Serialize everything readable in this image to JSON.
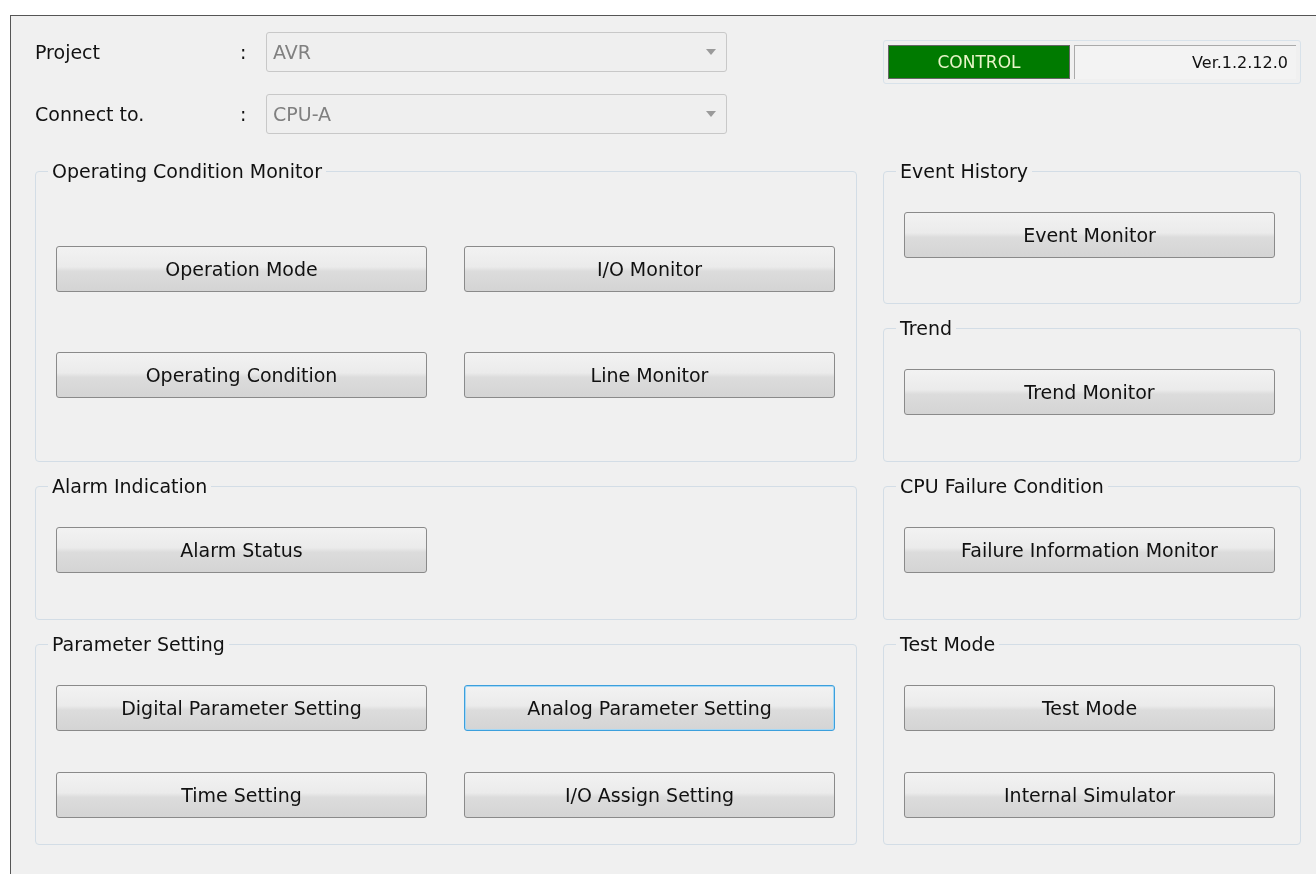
{
  "header": {
    "fields": [
      {
        "label": "Project",
        "separator": ":",
        "value": "AVR",
        "disabled": true
      },
      {
        "label": "Connect to.",
        "separator": ":",
        "value": "CPU-A",
        "disabled": true
      }
    ],
    "status": {
      "mode": "CONTROL",
      "version": "Ver.1.2.12.0"
    }
  },
  "left_groups": [
    {
      "title": "Operating Condition Monitor",
      "buttons": [
        {
          "label": "Operation Mode",
          "focused": false
        },
        {
          "label": "I/O Monitor",
          "focused": false
        },
        {
          "label": "Operating Condition",
          "focused": false
        },
        {
          "label": "Line Monitor",
          "focused": false
        }
      ]
    },
    {
      "title": "Alarm Indication",
      "buttons": [
        {
          "label": "Alarm Status",
          "focused": false
        }
      ]
    },
    {
      "title": "Parameter Setting",
      "buttons": [
        {
          "label": "Digital Parameter Setting",
          "focused": false
        },
        {
          "label": "Analog Parameter Setting",
          "focused": true
        },
        {
          "label": "Time Setting",
          "focused": false
        },
        {
          "label": "I/O Assign Setting",
          "focused": false
        }
      ]
    }
  ],
  "right_groups": [
    {
      "title": "Event History",
      "buttons": [
        {
          "label": "Event Monitor",
          "focused": false
        }
      ]
    },
    {
      "title": "Trend",
      "buttons": [
        {
          "label": "Trend Monitor",
          "focused": false
        }
      ]
    },
    {
      "title": "CPU Failure Condition",
      "buttons": [
        {
          "label": "Failure Information Monitor",
          "focused": false
        }
      ]
    },
    {
      "title": "Test Mode",
      "buttons": [
        {
          "label": "Test Mode",
          "focused": false
        },
        {
          "label": "Internal Simulator",
          "focused": false
        }
      ]
    }
  ]
}
